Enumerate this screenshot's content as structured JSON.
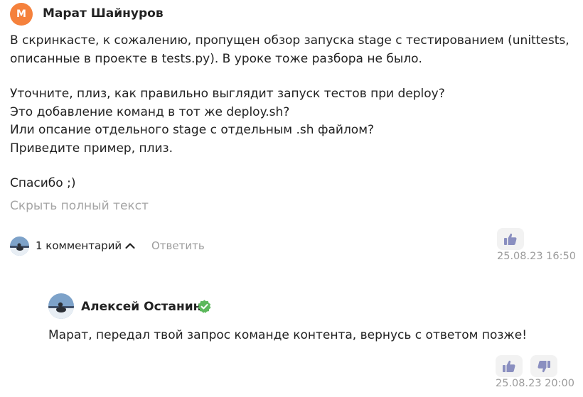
{
  "post": {
    "avatar_letter": "М",
    "author": "Марат Шайнуров",
    "paragraphs": [
      "В скринкасте, к сожалению, пропущен обзор запуска stage с тестированием (unittests, описанные в проекте в tests.py). В уроке тоже разбора не было.",
      "Уточните, плиз, как правильно выглядит запуск тестов при deploy?",
      "Это добавление команд в тот же deploy.sh?",
      "Или опсание отдельного stage с отдельным .sh файлом?",
      "Приведите пример, плиз.",
      "Спасибо ;)"
    ],
    "hide_full_text": "Скрыть полный текст",
    "comments_count_label": "1 комментарий",
    "reply_label": "Ответить",
    "timestamp": "25.08.23 16:50"
  },
  "reply_comment": {
    "author": "Алексей Останин",
    "text": "Марат, передал твой запрос команде контента, вернусь с ответом позже!",
    "timestamp": "25.08.23 20:00"
  },
  "colors": {
    "avatar_orange": "#f5813c",
    "verified_green": "#5cb85c",
    "muted_text": "#9c9c9c",
    "vote_button_bg": "#f2f2f2",
    "vote_icon": "#8a8fc0"
  },
  "icons": {
    "like": "thumbs-up-icon",
    "dislike": "thumbs-down-icon",
    "collapse": "chevron-up-icon",
    "verified": "verified-check-icon"
  }
}
